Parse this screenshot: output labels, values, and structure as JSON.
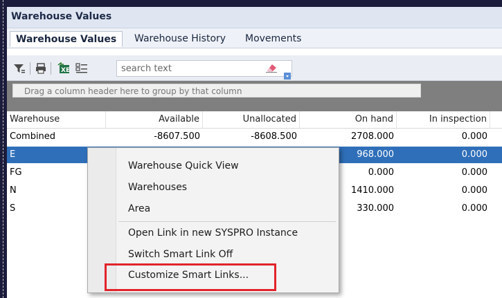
{
  "window": {
    "title": "Warehouse Values"
  },
  "tabs": [
    {
      "label": "Warehouse Values",
      "active": true
    },
    {
      "label": "Warehouse History",
      "active": false
    },
    {
      "label": "Movements",
      "active": false
    }
  ],
  "toolbar": {
    "icons": [
      "filter-icon",
      "print-icon",
      "excel-export-icon",
      "column-chooser-icon",
      "eraser-icon"
    ],
    "search_placeholder": "search text"
  },
  "group_area": {
    "hint": "Drag a column header here to group by that column"
  },
  "grid": {
    "columns": [
      "Warehouse",
      "Available",
      "Unallocated",
      "On hand",
      "In inspection"
    ],
    "rows": [
      {
        "warehouse": "Combined",
        "available": "-8607.500",
        "unallocated": "-8608.500",
        "on_hand": "2708.000",
        "in_inspection": "0.000",
        "selected": false
      },
      {
        "warehouse": "E",
        "available": "",
        "unallocated": "",
        "on_hand": "968.000",
        "in_inspection": "0.000",
        "selected": true
      },
      {
        "warehouse": "FG",
        "available": "",
        "unallocated": "",
        "on_hand": "0.000",
        "in_inspection": "0.000",
        "selected": false
      },
      {
        "warehouse": "N",
        "available": "",
        "unallocated": "",
        "on_hand": "1410.000",
        "in_inspection": "0.000",
        "selected": false
      },
      {
        "warehouse": "S",
        "available": "",
        "unallocated": "",
        "on_hand": "330.000",
        "in_inspection": "0.000",
        "selected": false
      }
    ]
  },
  "context_menu": {
    "items": [
      "Warehouse Quick View",
      "Warehouses",
      "Area",
      "Open Link in new SYSPRO Instance",
      "Switch Smart Link Off",
      "Customize Smart Links..."
    ],
    "highlighted_item": "Customize Smart Links...",
    "highlight_color": "#e2232a"
  },
  "colors": {
    "selection": "#2f6fb9",
    "titlebar": "#dfe6f2",
    "frame": "#1c1c3c"
  }
}
